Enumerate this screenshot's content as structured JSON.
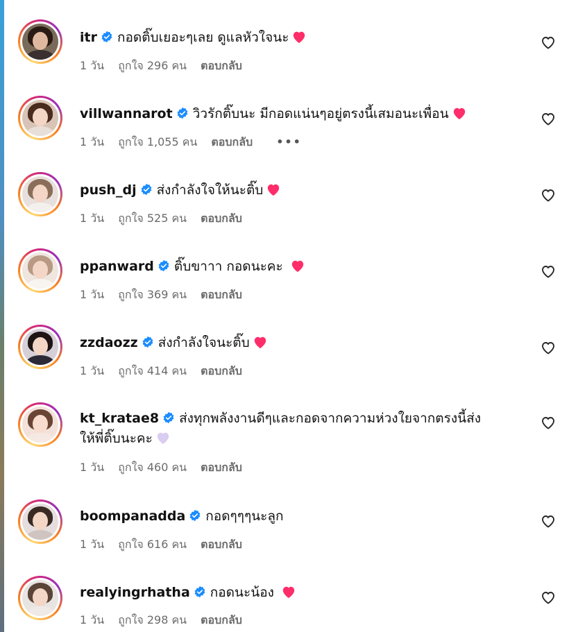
{
  "colors": {
    "verified": "#1a8cff",
    "heart_red": "#ff2d6a",
    "heart_lavender": "#d9cdf2",
    "meta_gray": "#6b6b6b",
    "avatar_ring": "#d62976"
  },
  "icons": {
    "verified": "verified-badge-icon",
    "like": "heart-outline-icon",
    "more": "more-options-icon"
  },
  "comments": [
    {
      "username": "itr",
      "text": "กอดติ๊บเยอะๆเลย ดูแลหัวใจนะ",
      "text2": "",
      "emoji": "red-heart",
      "time": "1 วัน",
      "likes": "ถูกใจ 296 คน",
      "reply": "ตอบกลับ",
      "more": ""
    },
    {
      "username": "villwannarot",
      "text": "วิวรักติ๊บนะ มีกอดแน่นๆอยู่ตรงนี้เสมอนะเพื่อน",
      "text2": "",
      "emoji": "red-heart",
      "time": "1 วัน",
      "likes": "ถูกใจ 1,055 คน",
      "reply": "ตอบกลับ",
      "more": "•••"
    },
    {
      "username": "push_dj",
      "text": "ส่งกำลังใจให้นะติ๊บ",
      "text2": "",
      "emoji": "red-heart",
      "time": "1 วัน",
      "likes": "ถูกใจ 525 คน",
      "reply": "ตอบกลับ",
      "more": ""
    },
    {
      "username": "ppanward",
      "text": "ติ๊บขาาา กอดนะคะ",
      "text2": "",
      "emoji": "red-heart",
      "time": "1 วัน",
      "likes": "ถูกใจ 369 คน",
      "reply": "ตอบกลับ",
      "more": ""
    },
    {
      "username": "zzdaozz",
      "text": "ส่งกำลังใจนะติ๊บ",
      "text2": "",
      "emoji": "red-heart",
      "time": "1 วัน",
      "likes": "ถูกใจ 414 คน",
      "reply": "ตอบกลับ",
      "more": ""
    },
    {
      "username": "kt_kratae8",
      "text": "ส่งทุกพลังงานดีๆและกอดจากความห่วงใยจากตรงนี้ส่ง",
      "text2": "ให้พี่ติ๊บนะคะ",
      "emoji": "lavender-heart",
      "time": "1 วัน",
      "likes": "ถูกใจ 460 คน",
      "reply": "ตอบกลับ",
      "more": ""
    },
    {
      "username": "boompanadda",
      "text": "กอดๆๆๆนะลูก",
      "text2": "",
      "emoji": "",
      "time": "1 วัน",
      "likes": "ถูกใจ 616 คน",
      "reply": "ตอบกลับ",
      "more": ""
    },
    {
      "username": "realyingrhatha",
      "text": "กอดนะน้อง",
      "text2": "",
      "emoji": "red-heart",
      "time": "1 วัน",
      "likes": "ถูกใจ 298 คน",
      "reply": "ตอบกลับ",
      "more": ""
    }
  ]
}
